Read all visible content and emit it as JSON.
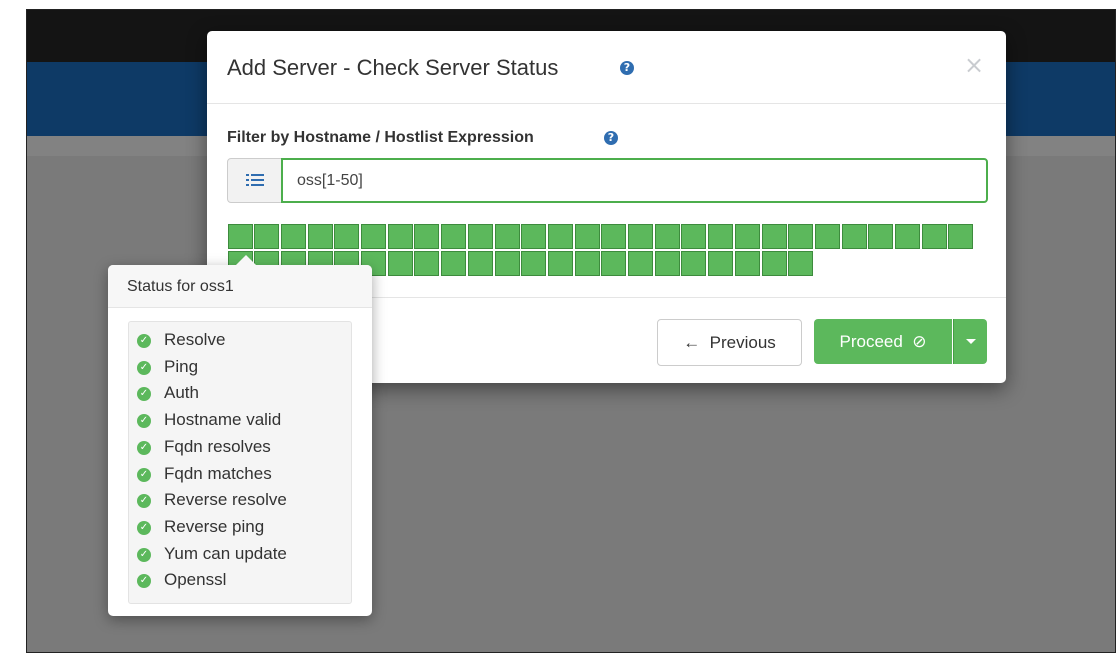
{
  "modal": {
    "title": "Add Server - Check Server Status",
    "filter_label": "Filter by Hostname / Hostlist Expression",
    "filter_value": "oss[1-50]",
    "close_glyph": "×",
    "help_glyph": "?",
    "list_icon": "list-icon",
    "server_count": 50,
    "servers_per_row": 28,
    "status_color": "#5cb85c"
  },
  "buttons": {
    "previous_arrow": "←",
    "previous_label": "Previous",
    "proceed_label": "Proceed",
    "proceed_icon": "⊘"
  },
  "popover": {
    "title": "Status for oss1",
    "checks": [
      {
        "label": "Resolve",
        "ok": true
      },
      {
        "label": "Ping",
        "ok": true
      },
      {
        "label": "Auth",
        "ok": true
      },
      {
        "label": "Hostname valid",
        "ok": true
      },
      {
        "label": "Fqdn resolves",
        "ok": true
      },
      {
        "label": "Fqdn matches",
        "ok": true
      },
      {
        "label": "Reverse resolve",
        "ok": true
      },
      {
        "label": "Reverse ping",
        "ok": true
      },
      {
        "label": "Yum can update",
        "ok": true
      },
      {
        "label": "Openssl",
        "ok": true
      }
    ]
  },
  "colors": {
    "accent_green": "#5cb85c",
    "navbar_blue": "#0e3a66",
    "help_blue": "#2f6db0"
  }
}
